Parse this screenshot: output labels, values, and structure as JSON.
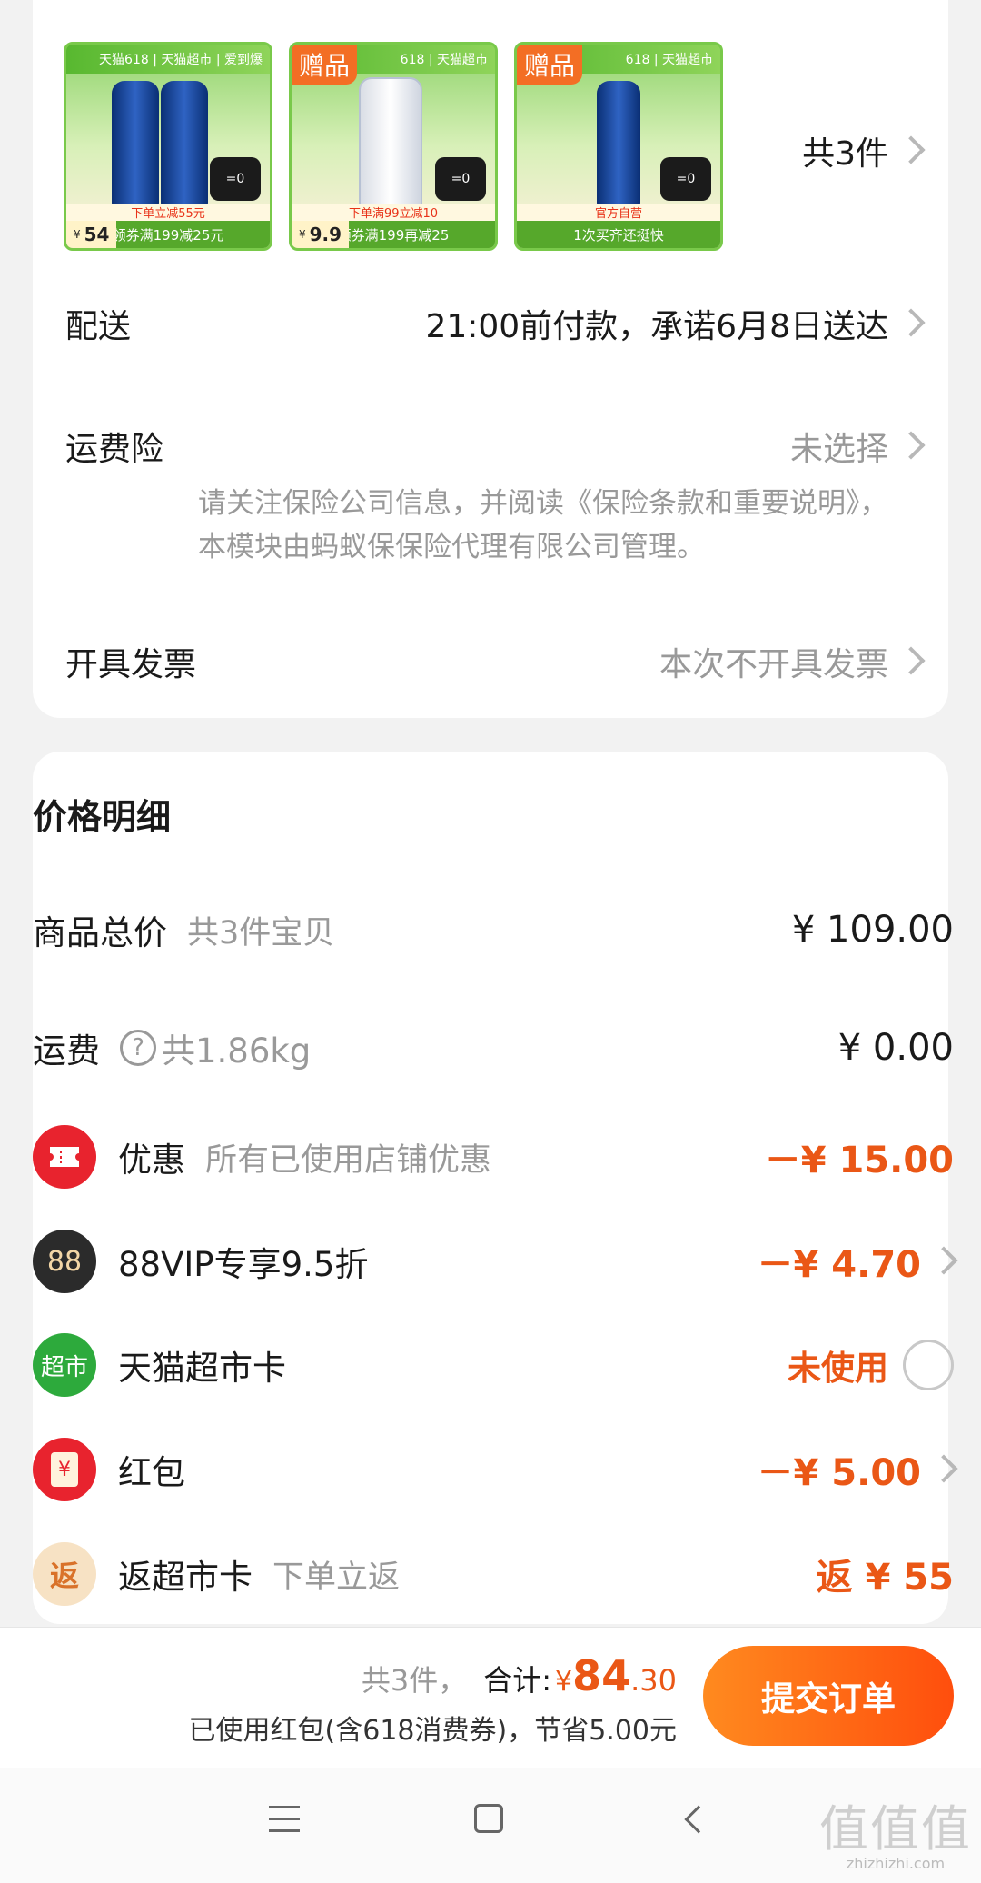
{
  "products": [
    {
      "top": "天猫618 | 天猫超市 | 爱到爆",
      "gift": "",
      "promo": "下单立减55元",
      "strip": "领券满199减25元",
      "price": "54",
      "price_prefix": "¥",
      "mascot": "=0"
    },
    {
      "top": "618 | 天猫超市",
      "gift": "赠品",
      "promo": "下单满99立减10",
      "strip": "领券满199再减25",
      "price": "9.9",
      "price_prefix": "¥",
      "mascot": "=0"
    },
    {
      "top": "618 | 天猫超市",
      "gift": "赠品",
      "promo": "官方自营",
      "strip": "1次买齐还挺快",
      "price": "",
      "price_prefix": "",
      "mascot": "=0"
    }
  ],
  "summary": {
    "count_label": "共3件"
  },
  "delivery": {
    "label": "配送",
    "value": "21:00前付款，承诺6月8日送达"
  },
  "insurance": {
    "label": "运费险",
    "value": "未选择",
    "notice": "请关注保险公司信息，并阅读《保险条款和重要说明》，本模块由蚂蚁保保险代理有限公司管理。"
  },
  "invoice": {
    "label": "开具发票",
    "value": "本次不开具发票"
  },
  "price_detail": {
    "title": "价格明细",
    "goods_total": {
      "label": "商品总价",
      "sub": "共3件宝贝",
      "amount": "¥ 109.00"
    },
    "shipping": {
      "label": "运费",
      "help_icon": "?",
      "sub": "共1.86kg",
      "amount": "¥ 0.00"
    },
    "discount": {
      "label": "优惠",
      "sub": "所有已使用店铺优惠",
      "amount": "－¥ 15.00",
      "icon": "ticket-icon",
      "color": "#e8232e"
    },
    "vip": {
      "label": "88VIP专享9.5折",
      "amount": "－¥ 4.70",
      "icon_text": "88",
      "color": "#2b2b2b"
    },
    "market_card": {
      "label": "天猫超市卡",
      "status": "未使用",
      "icon_text": "超市",
      "color": "#2daa3c"
    },
    "red_packet": {
      "label": "红包",
      "amount": "－¥ 5.00",
      "icon_text": "¥",
      "color": "#e8232e"
    },
    "rebate": {
      "label": "返超市卡",
      "sub": "下单立返",
      "amount": "返 ¥ 55",
      "icon_text": "返",
      "color": "#f7e2c4"
    }
  },
  "bottom": {
    "count": "共3件，",
    "total_label": "合计:",
    "yen": "¥",
    "total_int": "84",
    "total_dec": ".30",
    "saving": "已使用红包(含618消费券)，节省5.00元",
    "submit": "提交订单"
  },
  "watermark": {
    "big": "值值值",
    "small": "zhizhizhi.com"
  }
}
